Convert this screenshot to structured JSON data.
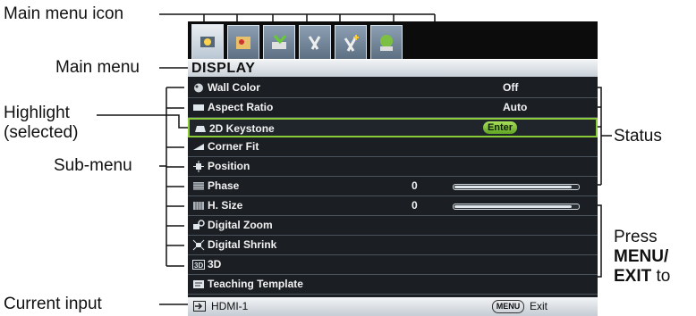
{
  "callouts": {
    "main_menu_icon": "Main menu icon",
    "main_menu": "Main menu",
    "highlight_line1": "Highlight",
    "highlight_line2": "(selected)",
    "sub_menu": "Sub-menu",
    "current_input": "Current input",
    "status": "Status",
    "press": "Press",
    "press_key": "MENU/",
    "press_key2": "EXIT",
    "press_to": "to"
  },
  "menu": {
    "title": "DISPLAY",
    "tabs": [
      "display-icon",
      "picture-icon",
      "source-icon",
      "system-basic-icon",
      "system-advanced-icon",
      "information-icon"
    ],
    "items": [
      {
        "label": "Wall Color",
        "value": "Off",
        "icon": "wall-color-icon"
      },
      {
        "label": "Aspect Ratio",
        "value": "Auto",
        "icon": "aspect-ratio-icon"
      },
      {
        "label": "2D Keystone",
        "button": "Enter",
        "icon": "keystone-icon",
        "selected": true
      },
      {
        "label": "Corner Fit",
        "icon": "corner-fit-icon"
      },
      {
        "label": "Position",
        "icon": "position-icon"
      },
      {
        "label": "Phase",
        "number": "0",
        "slider": 0.0,
        "icon": "phase-icon"
      },
      {
        "label": "H. Size",
        "number": "0",
        "slider": 0.0,
        "icon": "h-size-icon"
      },
      {
        "label": "Digital Zoom",
        "icon": "digital-zoom-icon"
      },
      {
        "label": "Digital Shrink",
        "icon": "digital-shrink-icon"
      },
      {
        "label": "3D",
        "icon": "3d-icon"
      },
      {
        "label": "Teaching Template",
        "icon": "teaching-template-icon"
      }
    ]
  },
  "status_bar": {
    "input": "HDMI-1",
    "menu_btn": "MENU",
    "exit": "Exit"
  }
}
